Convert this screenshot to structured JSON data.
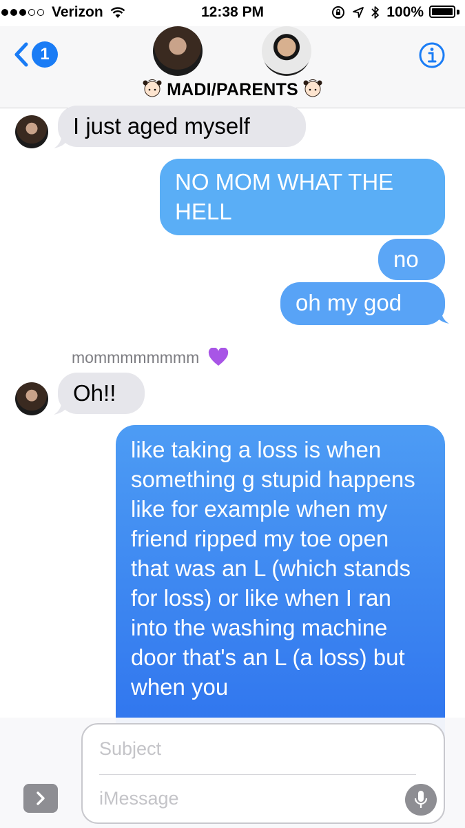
{
  "status_bar": {
    "carrier": "Verizon",
    "time": "12:38 PM",
    "battery": "100%",
    "signal_filled": 3,
    "signal_total": 5
  },
  "header": {
    "back_badge": "1",
    "group_name": "MADI/PARENTS",
    "title_emoji": "girl-face-icon",
    "info_icon": "info-icon"
  },
  "messages": [
    {
      "direction": "incoming",
      "text": "I just aged myself"
    },
    {
      "direction": "outgoing",
      "text": "NO MOM WHAT THE HELL"
    },
    {
      "direction": "outgoing",
      "text": "no"
    },
    {
      "direction": "outgoing",
      "text": "oh my god"
    },
    {
      "direction": "incoming",
      "sender": "mommmmmmmm",
      "sender_emoji": "purple-heart-icon",
      "text": "Oh!!"
    },
    {
      "direction": "outgoing",
      "text": "like taking a loss is when something g stupid happens like for example when my friend ripped my toe open that was an L (which stands for loss) or like when I ran into the washing machine door that's an L (a loss) but when you"
    }
  ],
  "composer": {
    "subject_placeholder": "Subject",
    "message_placeholder": "iMessage"
  },
  "colors": {
    "ios_blue": "#1a7cf5",
    "incoming_bubble": "#e6e6eb",
    "outgoing_bubble_light": "#5aaef6",
    "outgoing_bubble_dark": "#2f74ee",
    "purple_heart": "#a855e6"
  }
}
